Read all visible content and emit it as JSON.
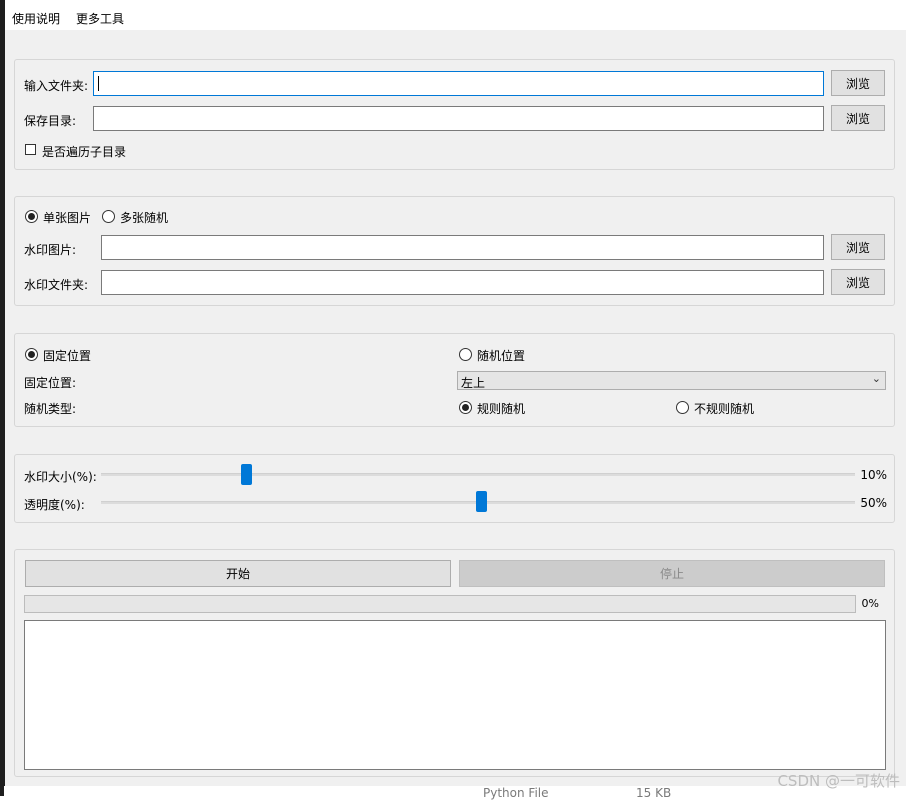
{
  "menu": {
    "items": [
      "使用说明",
      "更多工具"
    ]
  },
  "input_group": {
    "input_folder_label": "输入文件夹:",
    "save_dir_label": "保存目录:",
    "input_folder_value": "",
    "save_dir_value": "",
    "browse_label": "浏览",
    "recursive_label": "是否遍历子目录",
    "recursive_checked": false
  },
  "watermark_group": {
    "single_label": "单张图片",
    "multi_label": "多张随机",
    "selected": "single",
    "image_label": "水印图片:",
    "folder_label": "水印文件夹:",
    "browse_label": "浏览"
  },
  "position_group": {
    "fixed_label": "固定位置",
    "random_label": "随机位置",
    "position_mode": "fixed",
    "fixed_pos_label": "固定位置:",
    "fixed_pos_value": "左上",
    "random_type_label": "随机类型:",
    "regular_label": "规则随机",
    "irregular_label": "不规则随机",
    "random_type": "regular"
  },
  "slider_group": {
    "size_label": "水印大小(%):",
    "size_value": 10,
    "size_text": "10%",
    "opacity_label": "透明度(%):",
    "opacity_value": 50,
    "opacity_text": "50%"
  },
  "run_group": {
    "start_label": "开始",
    "stop_label": "停止",
    "progress_value": 0,
    "progress_text": "0%"
  },
  "background": {
    "file_type": "Python File",
    "file_size": "15 KB",
    "watermark": "CSDN @一可软件"
  },
  "colors": {
    "accent": "#0078d7",
    "window_bg": "#f0f0f0"
  }
}
